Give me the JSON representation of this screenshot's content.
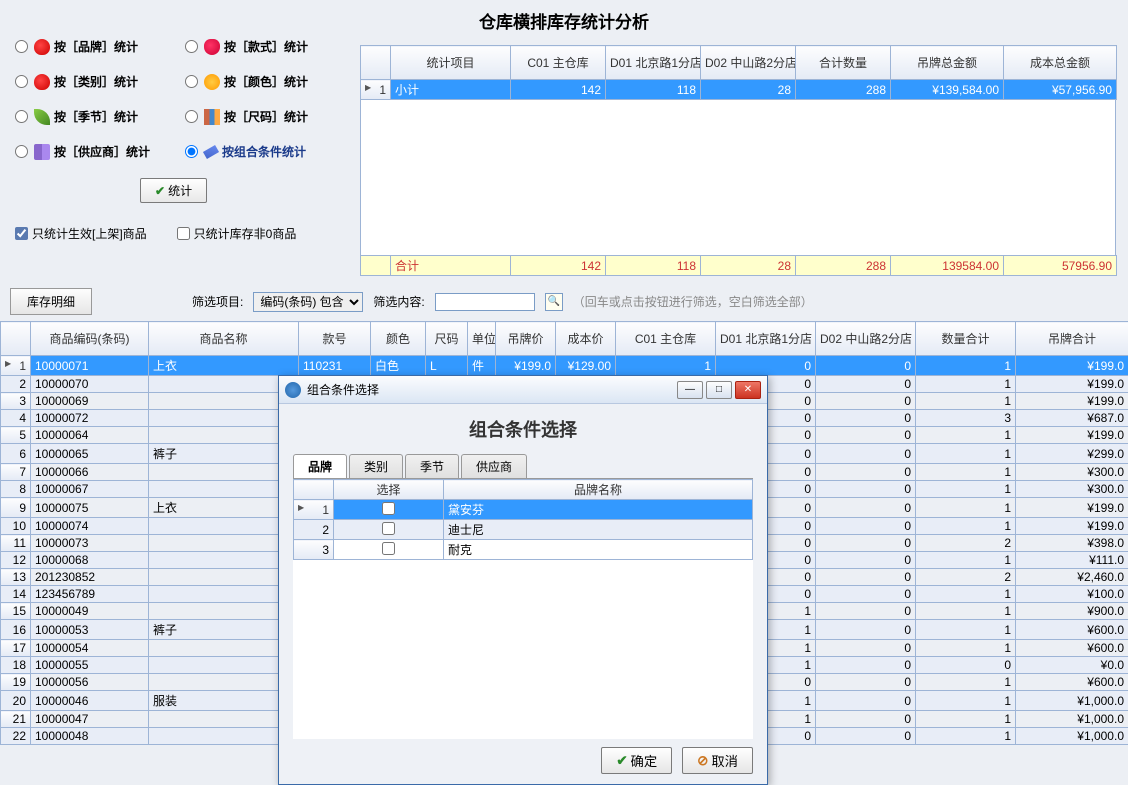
{
  "page_title": "仓库横排库存统计分析",
  "options": [
    {
      "label": "按［品牌］统计",
      "icon": "apple"
    },
    {
      "label": "按［款式］统计",
      "icon": "straw"
    },
    {
      "label": "按［类别］统计",
      "icon": "apple"
    },
    {
      "label": "按［颜色］统计",
      "icon": "face"
    },
    {
      "label": "按［季节］统计",
      "icon": "leaf"
    },
    {
      "label": "按［尺码］统计",
      "icon": "chart"
    },
    {
      "label": "按［供应商］统计",
      "icon": "book"
    },
    {
      "label": "按组合条件统计",
      "icon": "pen",
      "selected": true
    }
  ],
  "stat_button": "统计",
  "check1": "只统计生效[上架]商品",
  "check2": "只统计库存非0商品",
  "summary": {
    "headers": [
      "统计项目",
      "C01 主仓库",
      "D01 北京路1分店",
      "D02 中山路2分店",
      "合计数量",
      "吊牌总金额",
      "成本总金额"
    ],
    "row": {
      "idx": "1",
      "name": "小计",
      "c01": "142",
      "d01": "118",
      "d02": "28",
      "qty": "288",
      "tag": "¥139,584.00",
      "cost": "¥57,956.90"
    },
    "total": {
      "name": "合计",
      "c01": "142",
      "d01": "118",
      "d02": "28",
      "qty": "288",
      "tag": "139584.00",
      "cost": "57956.90"
    }
  },
  "detail_tab": "库存明细",
  "filter": {
    "label": "筛选项目:",
    "option": "编码(条码) 包含",
    "content_label": "筛选内容:",
    "hint": "（回车或点击按钮进行筛选，空白筛选全部）"
  },
  "detail": {
    "headers": [
      "商品编码(条码)",
      "商品名称",
      "款号",
      "颜色",
      "尺码",
      "单位",
      "吊牌价",
      "成本价",
      "C01 主仓库",
      "D01 北京路1分店",
      "D02 中山路2分店",
      "数量合计",
      "吊牌合计"
    ],
    "rows": [
      {
        "i": 1,
        "sel": true,
        "code": "10000071",
        "name": "上衣",
        "style": "110231",
        "color": "白色",
        "size": "L",
        "unit": "件",
        "tag": "¥199.0",
        "cost": "¥129.00",
        "c01": "1",
        "d01": "0",
        "d02": "0",
        "qty": "1",
        "sum": "¥199.0"
      },
      {
        "i": 2,
        "code": "10000070",
        "d01": "0",
        "d02": "0",
        "qty": "1",
        "sum": "¥199.0"
      },
      {
        "i": 3,
        "code": "10000069",
        "d01": "0",
        "d02": "0",
        "qty": "1",
        "sum": "¥199.0"
      },
      {
        "i": 4,
        "code": "10000072",
        "d01": "0",
        "d02": "0",
        "qty": "3",
        "sum": "¥687.0"
      },
      {
        "i": 5,
        "code": "10000064",
        "d01": "0",
        "d02": "0",
        "qty": "1",
        "sum": "¥199.0"
      },
      {
        "i": 6,
        "code": "10000065",
        "name": "裤子",
        "d01": "0",
        "d02": "0",
        "qty": "1",
        "sum": "¥299.0"
      },
      {
        "i": 7,
        "code": "10000066",
        "d01": "0",
        "d02": "0",
        "qty": "1",
        "sum": "¥300.0"
      },
      {
        "i": 8,
        "code": "10000067",
        "d01": "0",
        "d02": "0",
        "qty": "1",
        "sum": "¥300.0"
      },
      {
        "i": 9,
        "code": "10000075",
        "name": "上衣",
        "d01": "0",
        "d02": "0",
        "qty": "1",
        "sum": "¥199.0"
      },
      {
        "i": 10,
        "code": "10000074",
        "d01": "0",
        "d02": "0",
        "qty": "1",
        "sum": "¥199.0"
      },
      {
        "i": 11,
        "code": "10000073",
        "d01": "0",
        "d02": "0",
        "qty": "2",
        "sum": "¥398.0"
      },
      {
        "i": 12,
        "code": "10000068",
        "d01": "0",
        "d02": "0",
        "qty": "1",
        "sum": "¥111.0"
      },
      {
        "i": 13,
        "code": "201230852",
        "d01": "0",
        "d02": "0",
        "qty": "2",
        "sum": "¥2,460.0"
      },
      {
        "i": 14,
        "code": "123456789",
        "d01": "0",
        "d02": "0",
        "qty": "1",
        "sum": "¥100.0"
      },
      {
        "i": 15,
        "code": "10000049",
        "d01": "1",
        "d02": "0",
        "qty": "1",
        "sum": "¥900.0"
      },
      {
        "i": 16,
        "code": "10000053",
        "name": "裤子",
        "d01": "1",
        "d02": "0",
        "qty": "1",
        "sum": "¥600.0"
      },
      {
        "i": 17,
        "code": "10000054",
        "d01": "1",
        "d02": "0",
        "qty": "1",
        "sum": "¥600.0"
      },
      {
        "i": 18,
        "code": "10000055",
        "d01": "1",
        "d02": "0",
        "qty": "0",
        "sum": "¥0.0"
      },
      {
        "i": 19,
        "code": "10000056",
        "d01": "0",
        "d02": "0",
        "qty": "1",
        "sum": "¥600.0"
      },
      {
        "i": 20,
        "code": "10000046",
        "name": "服装",
        "d01": "1",
        "d02": "0",
        "qty": "1",
        "sum": "¥1,000.0"
      },
      {
        "i": 21,
        "code": "10000047",
        "d01": "1",
        "d02": "0",
        "qty": "1",
        "sum": "¥1,000.0"
      },
      {
        "i": 22,
        "code": "10000048",
        "d01": "0",
        "d02": "0",
        "qty": "1",
        "sum": "¥1,000.0"
      }
    ]
  },
  "dialog": {
    "title": "组合条件选择",
    "heading": "组合条件选择",
    "tabs": [
      "品牌",
      "类别",
      "季节",
      "供应商"
    ],
    "grid_headers": [
      "选择",
      "品牌名称"
    ],
    "rows": [
      {
        "i": 1,
        "name": "黛安芬",
        "sel": true
      },
      {
        "i": 2,
        "name": "迪士尼"
      },
      {
        "i": 3,
        "name": "耐克"
      }
    ],
    "ok": "确定",
    "cancel": "取消"
  }
}
